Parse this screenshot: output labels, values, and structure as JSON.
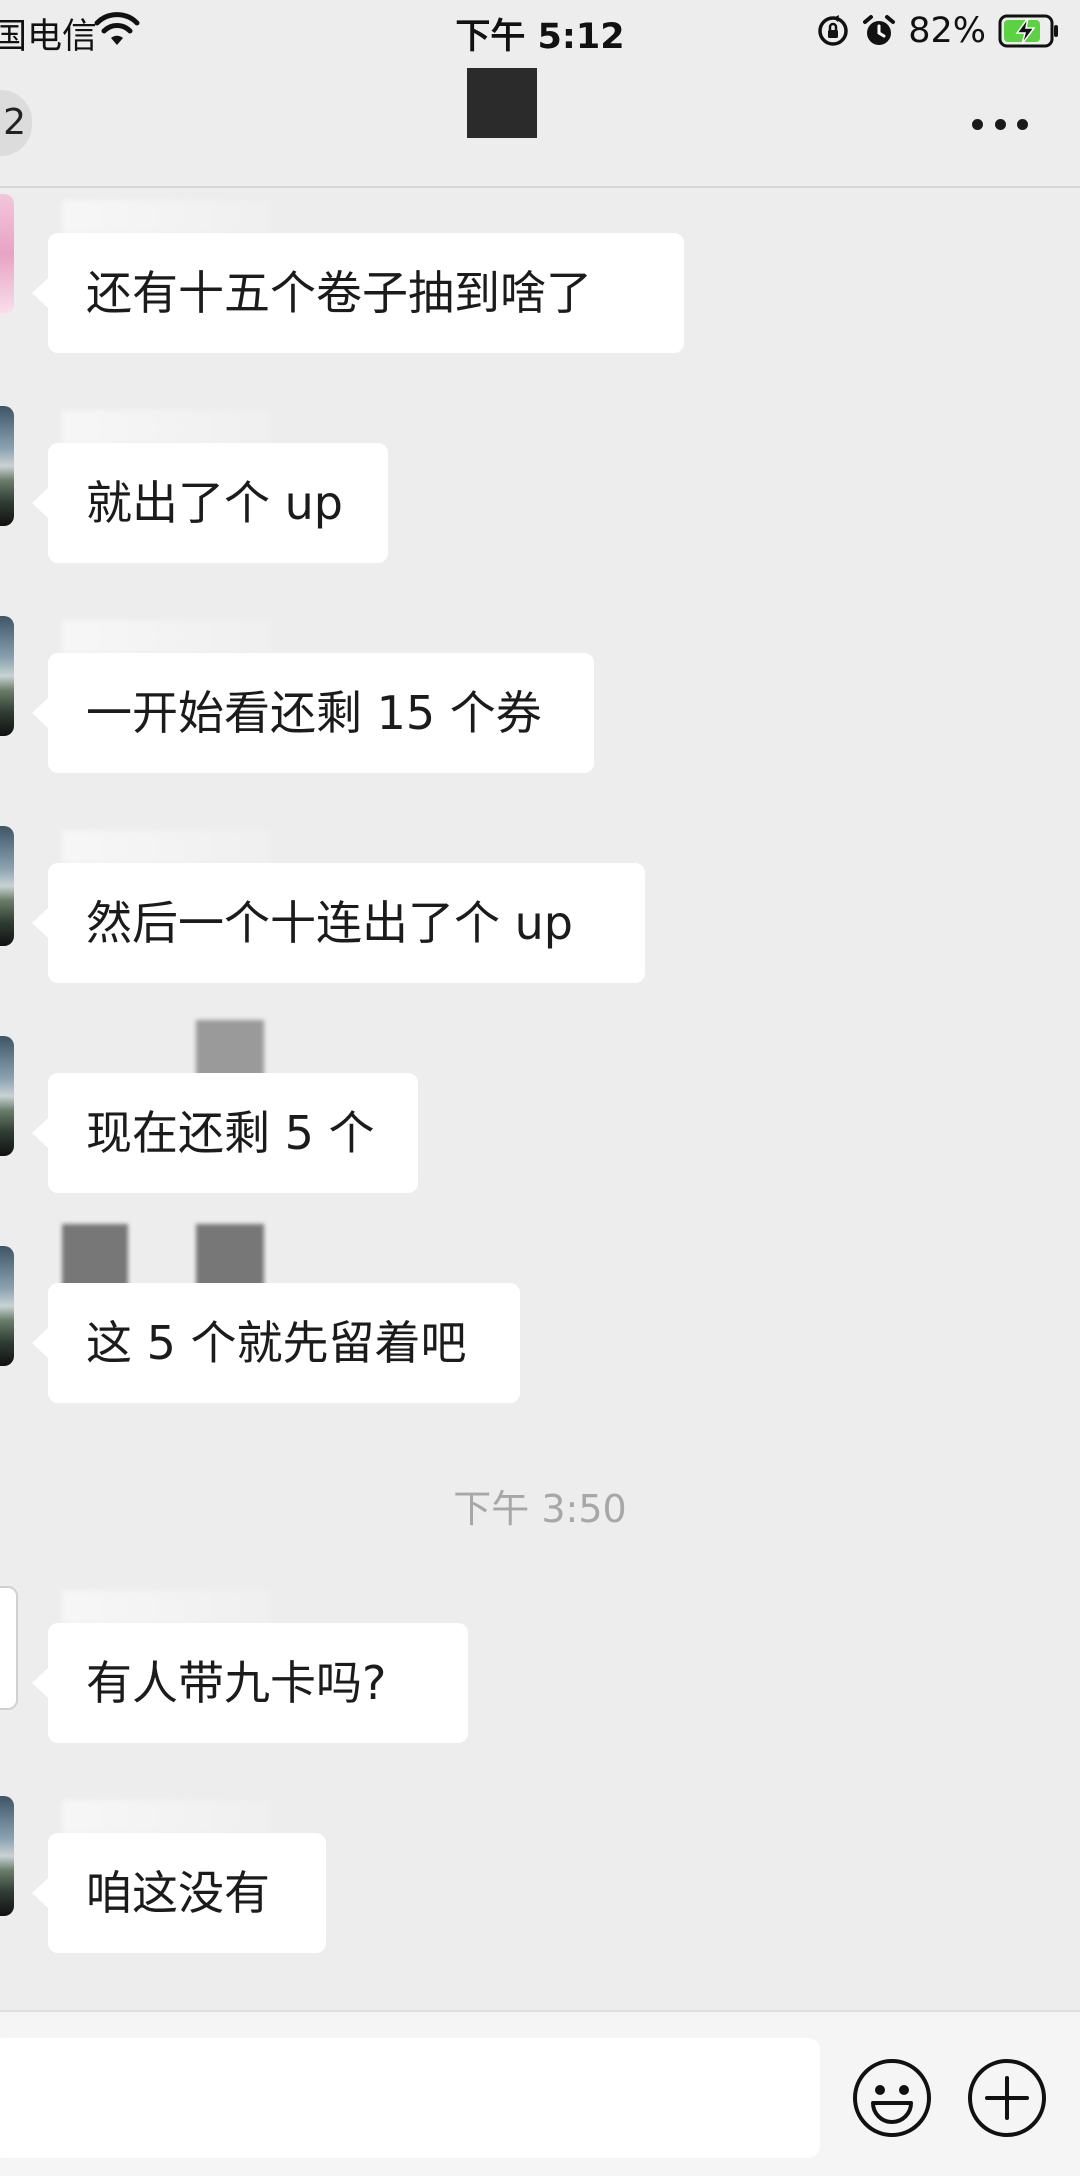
{
  "status_bar": {
    "carrier": "国电信",
    "time": "下午 5:12",
    "battery_percent": "82%",
    "battery_level": 0.82,
    "icons": [
      "wifi-icon",
      "rotation-lock-icon",
      "alarm-icon",
      "battery-charging-icon"
    ]
  },
  "nav": {
    "back_badge": "2",
    "more_icon": "more-icon"
  },
  "messages": [
    {
      "text": "还有十五个卷子抽到啥了",
      "avatar": "pink"
    },
    {
      "text": "就出了个 up",
      "avatar": "scenic"
    },
    {
      "text": "一开始看还剩 15 个券",
      "avatar": "scenic"
    },
    {
      "text": "然后一个十连出了个 up",
      "avatar": "scenic"
    },
    {
      "text": "现在还剩 5 个",
      "avatar": "scenic"
    },
    {
      "text": "这 5 个就先留着吧",
      "avatar": "scenic"
    },
    {
      "text": "有人带九卡吗?",
      "avatar": "sketch"
    },
    {
      "text": "咱这没有",
      "avatar": "scenic"
    }
  ],
  "timestamp": "下午 3:50",
  "input_bar": {
    "value": "",
    "icons": [
      "emoji-icon",
      "plus-icon"
    ]
  },
  "colors": {
    "background": "#ededed",
    "bubble": "#ffffff",
    "timestamp": "#a7a7a7",
    "battery_fill": "#5ad241"
  }
}
